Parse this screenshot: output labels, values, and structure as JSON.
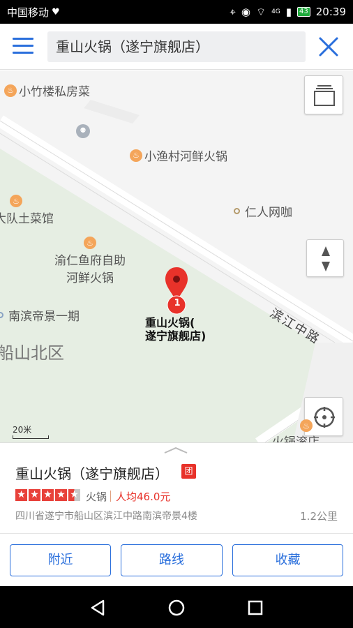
{
  "status_bar": {
    "carrier": "中国移动",
    "network": "4G",
    "battery": "43",
    "time": "20:39"
  },
  "search": {
    "query": "重山火锅（遂宁旗舰店）"
  },
  "map": {
    "pois": [
      {
        "label": "小竹楼私房菜"
      },
      {
        "label": "小渔村河鲜火锅"
      },
      {
        "label": "仁人网咖"
      },
      {
        "label": "大队土菜馆"
      },
      {
        "label": "渝仁鱼府自助"
      },
      {
        "label": "河鲜火锅"
      },
      {
        "label": "南滨帝景一期"
      },
      {
        "label": "火锅滚店"
      }
    ],
    "district": "船山北区",
    "road_name": "滨江中路",
    "marker": {
      "index": "1",
      "label_line1": "重山火锅(",
      "label_line2": "遂宁旗舰店)"
    },
    "scale_label": "20米",
    "colors": {
      "park": "#e8efe6",
      "road": "#ffffff",
      "marker": "#e8322a"
    }
  },
  "place": {
    "name": "重山火锅（遂宁旗舰店）",
    "badge": "团",
    "rating": 4.5,
    "category": "火锅",
    "price": "人均46.0元",
    "address": "四川省遂宁市船山区滨江中路南滨帝景4楼",
    "distance": "1.2公里"
  },
  "actions": {
    "nearby": "附近",
    "route": "路线",
    "favorite": "收藏"
  }
}
